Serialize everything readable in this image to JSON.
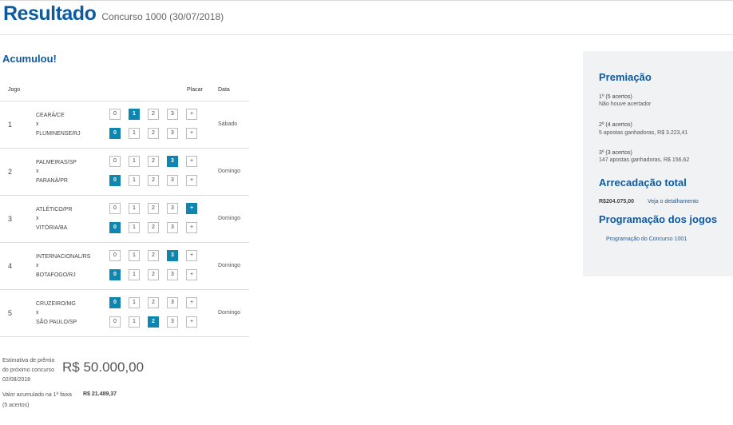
{
  "header": {
    "title": "Resultado",
    "subtitle": "Concurso 1000 (30/07/2018)"
  },
  "status": "Acumulou!",
  "table_headers": {
    "jogo": "Jogo",
    "placar": "Placar",
    "data": "Data"
  },
  "score_options": [
    "0",
    "1",
    "2",
    "3",
    "+"
  ],
  "games": [
    {
      "number": "1",
      "home": "CEARÁ/CE",
      "vs": "x",
      "away": "FLUMINENSE/RJ",
      "home_score": "1",
      "away_score": "0",
      "date": "Sábado"
    },
    {
      "number": "2",
      "home": "PALMEIRAS/SP",
      "vs": "x",
      "away": "PARANÁ/PR",
      "home_score": "3",
      "away_score": "0",
      "date": "Domingo"
    },
    {
      "number": "3",
      "home": "ATLÉTICO/PR",
      "vs": "x",
      "away": "VITÓRIA/BA",
      "home_score": "+",
      "away_score": "0",
      "date": "Domingo"
    },
    {
      "number": "4",
      "home": "INTERNACIONAL/RS",
      "vs": "x",
      "away": "BOTAFOGO/RJ",
      "home_score": "3",
      "away_score": "0",
      "date": "Domingo"
    },
    {
      "number": "5",
      "home": "CRUZEIRO/MG",
      "vs": "x",
      "away": "SÃO PAULO/SP",
      "home_score": "0",
      "away_score": "2",
      "date": "Domingo"
    }
  ],
  "estimate": {
    "label_lines": [
      "Estimativa de prêmio",
      "do próximo concurso",
      "02/08/2018"
    ],
    "value": "R$ 50.000,00"
  },
  "accumulated": {
    "label_lines": [
      "Valor acumulado na 1ª faixa",
      "(5 acertos)"
    ],
    "value": "R$ 21.489,37"
  },
  "sidebar": {
    "premiacao": {
      "title": "Premiação",
      "tiers": [
        {
          "label": "1º (5 acertos)",
          "detail": "Não houve acertador"
        },
        {
          "label": "2º (4 acertos)",
          "detail": "5 apostas ganhadoras, R$ 3.223,41"
        },
        {
          "label": "3º (3 acertos)",
          "detail": "147 apostas ganhadoras, R$ 156,62"
        }
      ]
    },
    "arrecadacao": {
      "title": "Arrecadação total",
      "value": "R$204.075,00",
      "link": "Veja o detalhamento"
    },
    "programacao": {
      "title": "Programação dos jogos",
      "link": "Programação do Concurso 1001"
    }
  },
  "colors": {
    "brand": "#0d5a9e",
    "selected": "#0e86b0",
    "panel_bg": "#f1f2f4"
  }
}
